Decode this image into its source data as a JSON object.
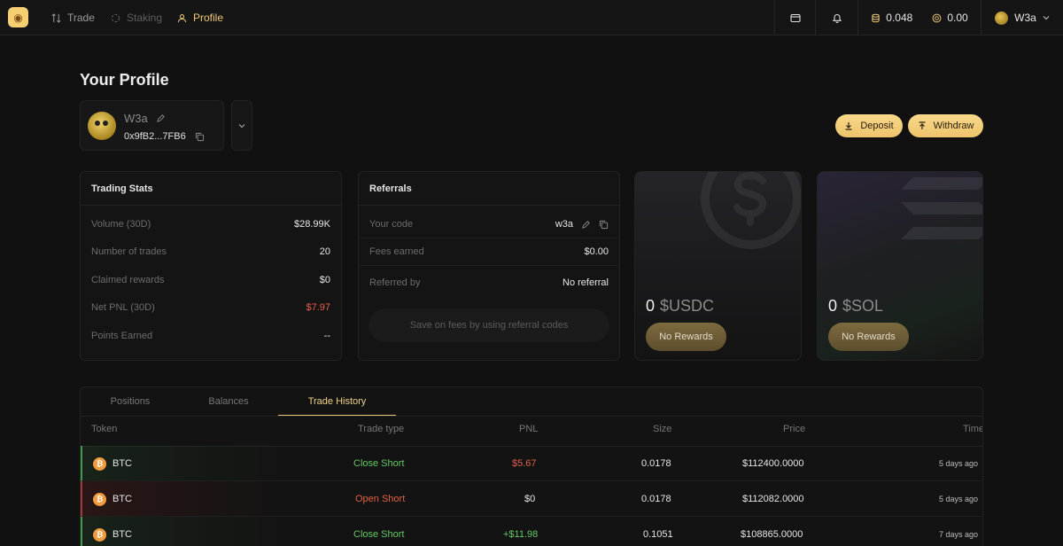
{
  "nav": {
    "trade": "Trade",
    "staking": "Staking",
    "profile": "Profile"
  },
  "topbar": {
    "balance_1": "0.048",
    "balance_2": "0.00",
    "username": "W3a"
  },
  "page": {
    "title": "Your Profile"
  },
  "profile": {
    "name": "W3a",
    "address": "0x9fB2...7FB6"
  },
  "actions": {
    "deposit": "Deposit",
    "withdraw": "Withdraw"
  },
  "trading_stats": {
    "title": "Trading Stats",
    "rows": [
      {
        "label": "Volume (30D)",
        "value": "$28.99K"
      },
      {
        "label": "Number of trades",
        "value": "20"
      },
      {
        "label": "Claimed rewards",
        "value": "$0"
      },
      {
        "label": "Net PNL (30D)",
        "value": "$7.97"
      },
      {
        "label": "Points Earned",
        "value": "--"
      }
    ]
  },
  "referrals": {
    "title": "Referrals",
    "rows": [
      {
        "label": "Your code",
        "value": "w3a"
      },
      {
        "label": "Fees earned",
        "value": "$0.00"
      },
      {
        "label": "Referred by",
        "value": "No referral"
      }
    ],
    "banner": "Save on fees by using referral codes"
  },
  "rewards": [
    {
      "amount": "0",
      "unit": "$USDC",
      "button": "No Rewards"
    },
    {
      "amount": "0",
      "unit": "$SOL",
      "button": "No Rewards"
    }
  ],
  "tabs": [
    "Positions",
    "Balances",
    "Trade History"
  ],
  "table": {
    "headers": {
      "token": "Token",
      "type": "Trade type",
      "pnl": "PNL",
      "size": "Size",
      "price": "Price",
      "time": "Time"
    },
    "rows": [
      {
        "token": "BTC",
        "type": "Close Short",
        "pnl": "$5.67",
        "size": "0.0178",
        "price": "$112400.0000",
        "time": "5 days ago"
      },
      {
        "token": "BTC",
        "type": "Open Short",
        "pnl": "$0",
        "size": "0.0178",
        "price": "$112082.0000",
        "time": "5 days ago"
      },
      {
        "token": "BTC",
        "type": "Close Short",
        "pnl": "+$11.98",
        "size": "0.1051",
        "price": "$108865.0000",
        "time": "7 days ago"
      }
    ]
  },
  "colors": {
    "accent_gold": "#f0c879",
    "positive": "#64c964",
    "negative": "#e0604a",
    "background": "#111111"
  }
}
